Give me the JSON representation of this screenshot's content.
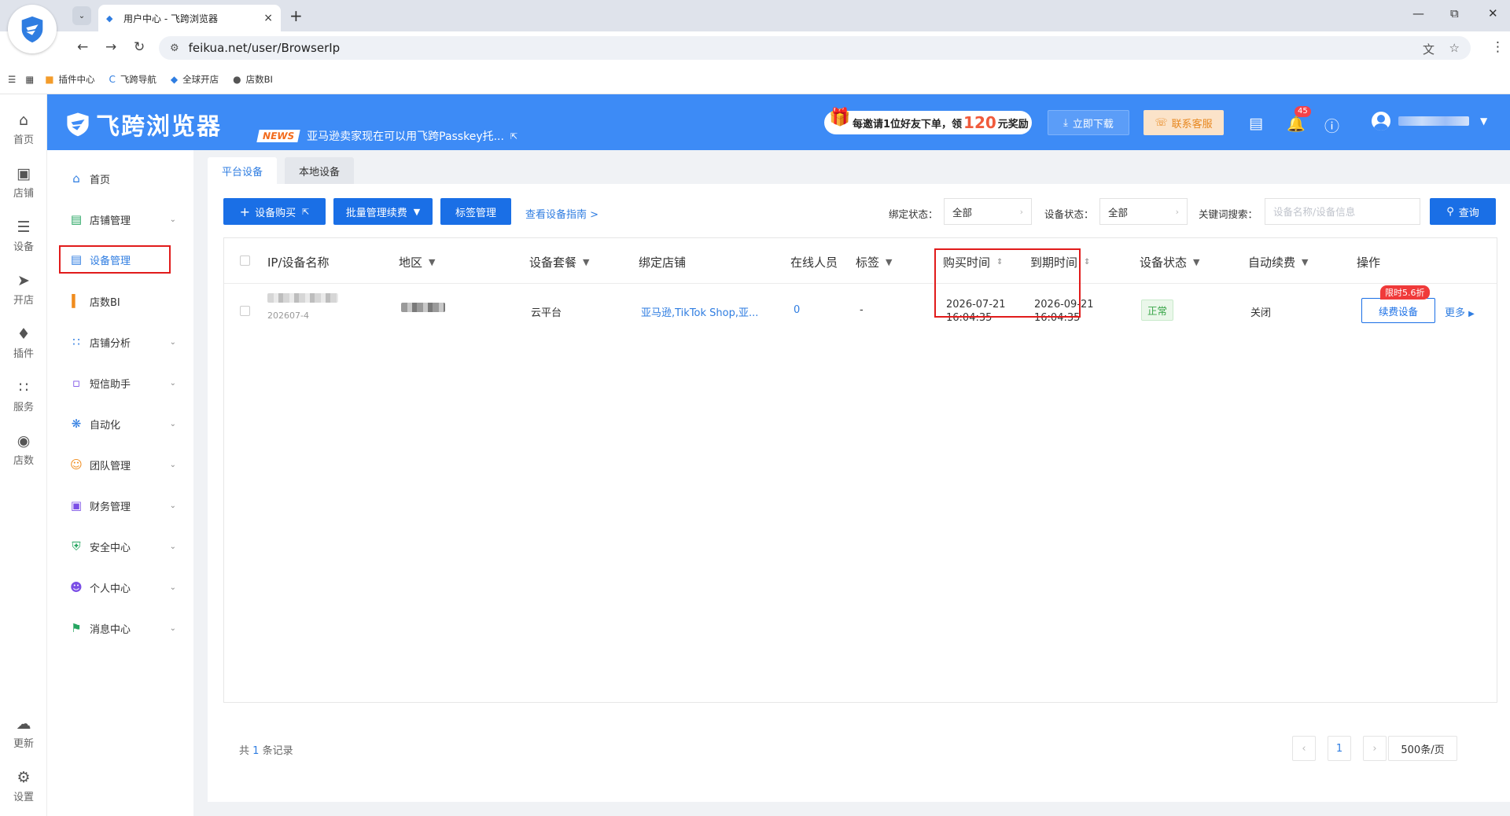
{
  "browser": {
    "tab_title": "用户中心 - 飞跨浏览器",
    "tab_close": "×",
    "new_tab": "+",
    "url": "feikua.net/user/BrowserIp",
    "bookmarks": [
      {
        "label": "插件中心",
        "icon": "puzzle-icon"
      },
      {
        "label": "飞跨导航",
        "icon": "feikua-icon"
      },
      {
        "label": "全球开店",
        "icon": "shop-icon"
      },
      {
        "label": "店数BI",
        "icon": "globe-icon"
      }
    ]
  },
  "rail": {
    "items": [
      {
        "label": "首页",
        "icon": "home-icon"
      },
      {
        "label": "店铺",
        "icon": "store-icon"
      },
      {
        "label": "设备",
        "icon": "layers-icon"
      },
      {
        "label": "开店",
        "icon": "rocket-icon"
      },
      {
        "label": "插件",
        "icon": "puzzle-icon"
      },
      {
        "label": "服务",
        "icon": "grid-icon"
      },
      {
        "label": "店数",
        "icon": "bi-icon"
      }
    ],
    "bottom": [
      {
        "label": "更新",
        "icon": "cloud-upload-icon"
      },
      {
        "label": "设置",
        "icon": "settings-icon"
      }
    ]
  },
  "header": {
    "brand": "飞跨浏览器",
    "news_badge": "NEWS",
    "news_text": "亚马逊卖家现在可以用飞跨Passkey托...",
    "invite_prefix": "每邀请1位好友下单，领",
    "invite_amount": "120",
    "invite_suffix": "元奖励",
    "download_label": "立即下载",
    "service_label": "联系客服",
    "notification_count": "45",
    "accent": "#3d8bf6"
  },
  "sidebar": {
    "items": [
      {
        "label": "首页",
        "icon": "home-icon",
        "expandable": false
      },
      {
        "label": "店铺管理",
        "icon": "store-icon",
        "expandable": true
      },
      {
        "label": "设备管理",
        "icon": "server-icon",
        "expandable": false,
        "active": true
      },
      {
        "label": "店数BI",
        "icon": "bar-chart-icon",
        "expandable": false
      },
      {
        "label": "店铺分析",
        "icon": "grid-icon",
        "expandable": true
      },
      {
        "label": "短信助手",
        "icon": "message-icon",
        "expandable": true
      },
      {
        "label": "自动化",
        "icon": "automation-icon",
        "expandable": true
      },
      {
        "label": "团队管理",
        "icon": "team-icon",
        "expandable": true
      },
      {
        "label": "财务管理",
        "icon": "wallet-icon",
        "expandable": true
      },
      {
        "label": "安全中心",
        "icon": "shield-icon",
        "expandable": true
      },
      {
        "label": "个人中心",
        "icon": "user-icon",
        "expandable": true
      },
      {
        "label": "消息中心",
        "icon": "bell-icon",
        "expandable": true
      }
    ]
  },
  "page_tabs": [
    "平台设备",
    "本地设备"
  ],
  "toolbar": {
    "buy_label": "设备购买",
    "batch_label": "批量管理续费",
    "tag_label": "标签管理",
    "guide_label": "查看设备指南 >"
  },
  "filters": {
    "bind_label": "绑定状态：",
    "bind_value": "全部",
    "status_label": "设备状态：",
    "status_value": "全部",
    "keyword_label": "关键词搜索：",
    "keyword_placeholder": "设备名称/设备信息",
    "query_label": "查询"
  },
  "table": {
    "columns": [
      "IP/设备名称",
      "地区",
      "设备套餐",
      "绑定店铺",
      "在线人员",
      "标签",
      "购买时间",
      "到期时间",
      "设备状态",
      "自动续费",
      "操作"
    ],
    "rows": [
      {
        "ip_sub": "202607-4",
        "plan": "云平台",
        "stores": "亚马逊,TikTok Shop,亚...",
        "online": "0",
        "tag": "-",
        "purchase_date": "2026-07-21",
        "purchase_time": "16:04:35",
        "expire_date": "2026-09-21",
        "expire_time": "16:04:35",
        "status": "正常",
        "auto_renew": "关闭",
        "renew_label": "续费设备",
        "promo_label": "限时5.6折",
        "more_label": "更多"
      }
    ]
  },
  "pager": {
    "total_prefix": "共",
    "total_count": "1",
    "total_suffix": "条记录",
    "current_page": "1",
    "page_size": "500条/页"
  }
}
